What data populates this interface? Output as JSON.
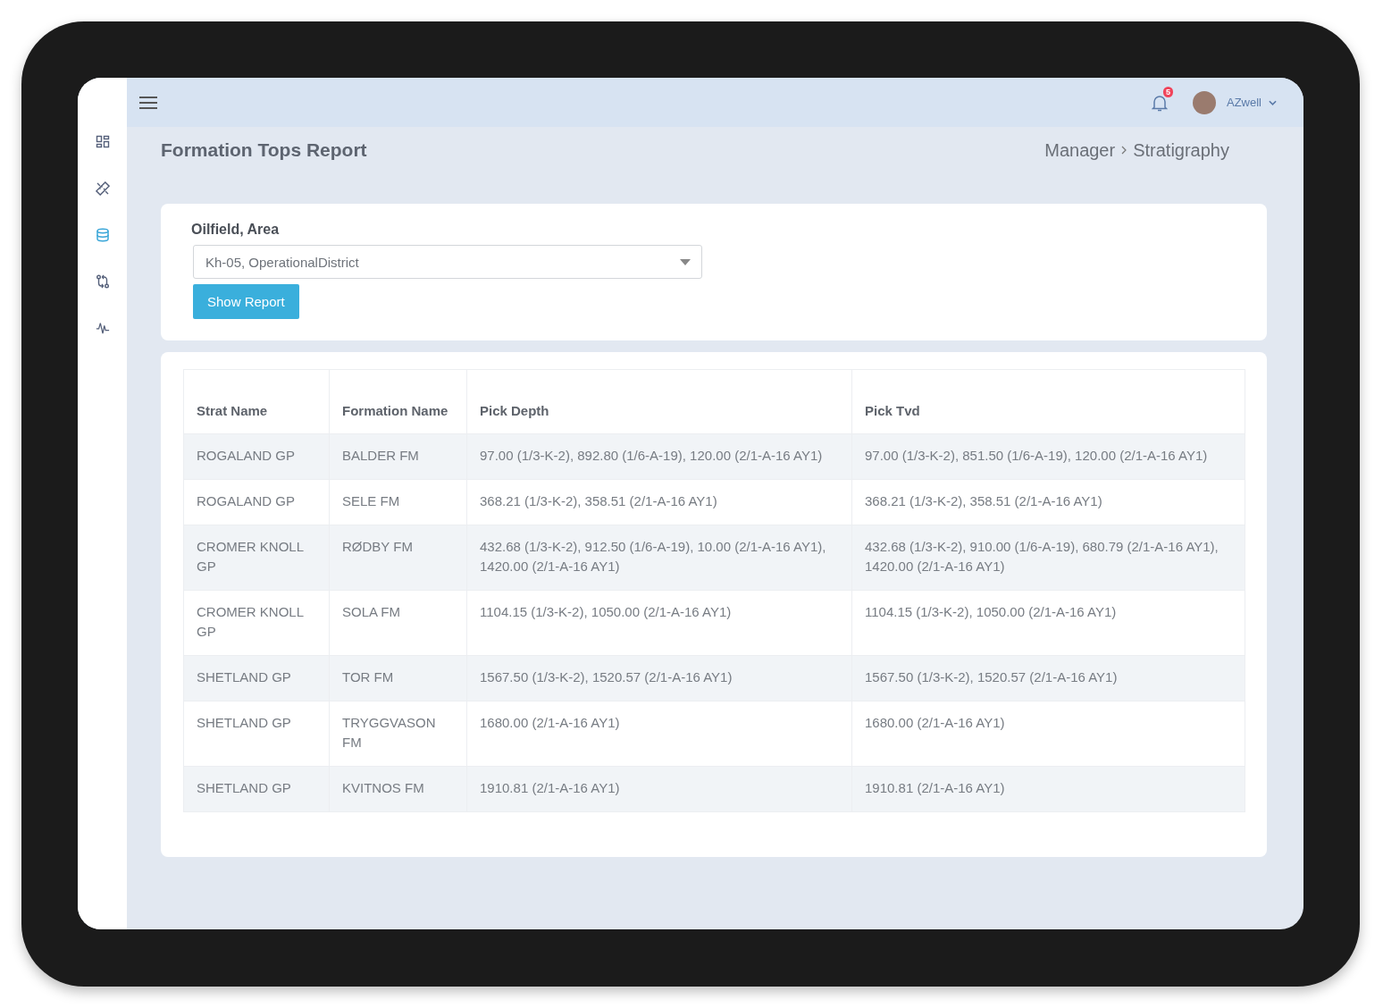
{
  "sidebar": {
    "items": [
      {
        "kind": "grid",
        "selected": false
      },
      {
        "kind": "ruler",
        "selected": false
      },
      {
        "kind": "database",
        "selected": true
      },
      {
        "kind": "flow",
        "selected": false
      },
      {
        "kind": "pulse",
        "selected": false
      }
    ]
  },
  "topbar": {
    "notifications": "5",
    "user": "AZwell"
  },
  "page": {
    "title": "Formation Tops Report",
    "breadcrumb": [
      "Manager",
      "Stratigraphy"
    ]
  },
  "filter": {
    "label": "Oilfield, Area",
    "value": "Kh-05, OperationalDistrict",
    "button": "Show Report"
  },
  "table": {
    "columns": [
      "Strat Name",
      "Formation Name",
      "Pick Depth",
      "Pick Tvd"
    ],
    "rows": [
      [
        "ROGALAND GP",
        "BALDER FM",
        "97.00 (1/3-K-2), 892.80 (1/6-A-19), 120.00 (2/1-A-16 AY1)",
        "97.00 (1/3-K-2), 851.50 (1/6-A-19), 120.00 (2/1-A-16 AY1)"
      ],
      [
        "ROGALAND GP",
        "SELE FM",
        "368.21 (1/3-K-2), 358.51 (2/1-A-16 AY1)",
        "368.21 (1/3-K-2), 358.51 (2/1-A-16 AY1)"
      ],
      [
        "CROMER KNOLL GP",
        "RØDBY FM",
        "432.68 (1/3-K-2), 912.50 (1/6-A-19), 10.00 (2/1-A-16 AY1), 1420.00 (2/1-A-16 AY1)",
        "432.68 (1/3-K-2), 910.00 (1/6-A-19), 680.79 (2/1-A-16 AY1), 1420.00 (2/1-A-16 AY1)"
      ],
      [
        "CROMER KNOLL GP",
        "SOLA FM",
        "1104.15 (1/3-K-2), 1050.00 (2/1-A-16 AY1)",
        "1104.15 (1/3-K-2), 1050.00 (2/1-A-16 AY1)"
      ],
      [
        "SHETLAND GP",
        "TOR FM",
        "1567.50 (1/3-K-2), 1520.57 (2/1-A-16 AY1)",
        "1567.50 (1/3-K-2), 1520.57 (2/1-A-16 AY1)"
      ],
      [
        "SHETLAND GP",
        "TRYGGVASON FM",
        "1680.00 (2/1-A-16 AY1)",
        "1680.00 (2/1-A-16 AY1)"
      ],
      [
        "SHETLAND GP",
        "KVITNOS FM",
        "1910.81 (2/1-A-16 AY1)",
        "1910.81 (2/1-A-16 AY1)"
      ]
    ]
  }
}
